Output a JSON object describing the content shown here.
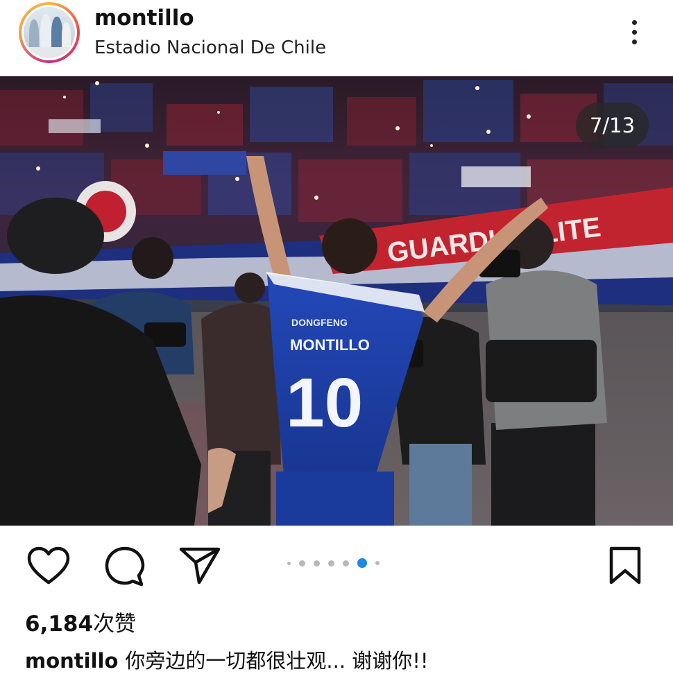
{
  "post": {
    "username": "montillo",
    "location": "Estadio Nacional De Chile",
    "photo_counter": "7/13",
    "likes_count": "6,184",
    "likes_label": "次赞",
    "caption_user": "montillo",
    "caption_text": "你旁边的一切都很壮观... 谢谢你!!",
    "jersey_sponsor": "DONGFENG",
    "jersey_name": "MONTILLO",
    "jersey_number": "10",
    "banner_text": "GUARDIA ELITE"
  },
  "carousel": {
    "total_dots": 7,
    "active_dot": 5
  },
  "icons": {
    "avatar": "family-photo",
    "more": "more-vertical-icon",
    "like": "heart-icon",
    "comment": "comment-bubble-icon",
    "share": "paper-plane-icon",
    "save": "bookmark-icon"
  },
  "colors": {
    "jersey_blue": "#1e3fa8",
    "counter_bg": "#282828",
    "active_dot": "#1e88e5",
    "inactive_dot": "#b8b8b8"
  }
}
